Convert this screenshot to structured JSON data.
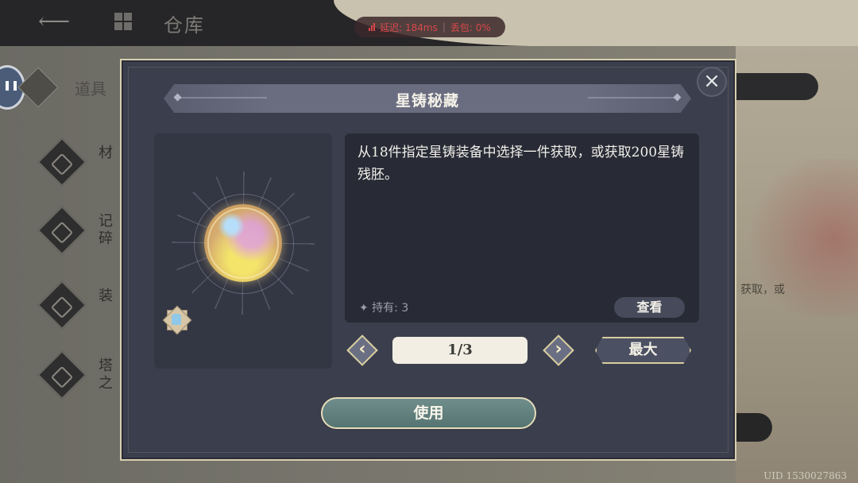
{
  "background": {
    "page_title": "仓库",
    "network": {
      "latency": "延迟: 184ms",
      "packet_loss": "丢包: 0%"
    },
    "tab_tools": "道具",
    "side_items": [
      {
        "label": "材"
      },
      {
        "label": "记碎"
      },
      {
        "label": "装"
      },
      {
        "label": "塔之"
      }
    ],
    "right_text": "获取，或",
    "uid_label": "UID",
    "uid_value": "1530027863"
  },
  "dialog": {
    "title": "星铸秘藏",
    "description": "从18件指定星铸装备中选择一件获取，或获取200星铸残胚。",
    "hold_label": "✦ 持有: 3",
    "view_label": "查看",
    "page": "1/3",
    "prev_icon": "chevron-left",
    "next_icon": "chevron-right",
    "max_label": "最大",
    "use_label": "使用",
    "close_icon": "×",
    "item_icon": "star-forge-orb"
  },
  "colors": {
    "dialog_bg": "#3b3e4c",
    "border_gold": "#d8cfb0",
    "use_button": "#6f8d8b",
    "net_warning": "#d9484b"
  }
}
